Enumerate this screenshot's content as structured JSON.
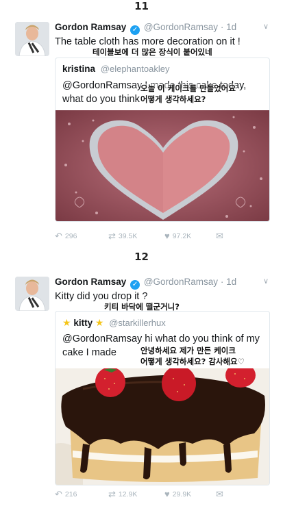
{
  "sections": [
    {
      "number": "11",
      "tweet": {
        "author_name": "Gordon Ramsay",
        "handle": "@GordonRamsay",
        "time": "· 1d",
        "text": "The table cloth has more decoration on it !",
        "translation": "테이블보에 더 많은 장식이 붙어있네",
        "quoted": {
          "author_name": "kristina",
          "handle": "@elephantoakley",
          "text": "@GordonRamsay I made this cake today, what do you think",
          "translation_line1": "오늘 이 케이크를 만들었어요",
          "translation_line2": "어떻게 생각하세요?"
        },
        "replies": "296",
        "retweets": "39.5K",
        "likes": "97.2K"
      }
    },
    {
      "number": "12",
      "tweet": {
        "author_name": "Gordon Ramsay",
        "handle": "@GordonRamsay",
        "time": "· 1d",
        "text": "Kitty did you drop it ?",
        "translation": "키티 바닥에 떨군거니?",
        "quoted": {
          "author_name": "kitty",
          "handle": "@starkillerhux",
          "text": "@GordonRamsay hi what do you think of my cake I made",
          "translation_line1": "안녕하세요 제가 만든 케이크",
          "translation_line2": "어떻게 생각하세요? 감사해요♡"
        },
        "replies": "216",
        "retweets": "12.9K",
        "likes": "29.9K"
      }
    }
  ],
  "icons": {
    "reply": "reply-icon",
    "retweet": "retweet-icon",
    "like": "heart-icon",
    "dm": "envelope-icon",
    "verified": "verified-badge-icon",
    "more": "chevron-down-icon",
    "star": "star-emoji-icon"
  },
  "colors": {
    "verified": "#1da1f2",
    "muted": "#8a96a0",
    "border": "#e1e8ed"
  }
}
